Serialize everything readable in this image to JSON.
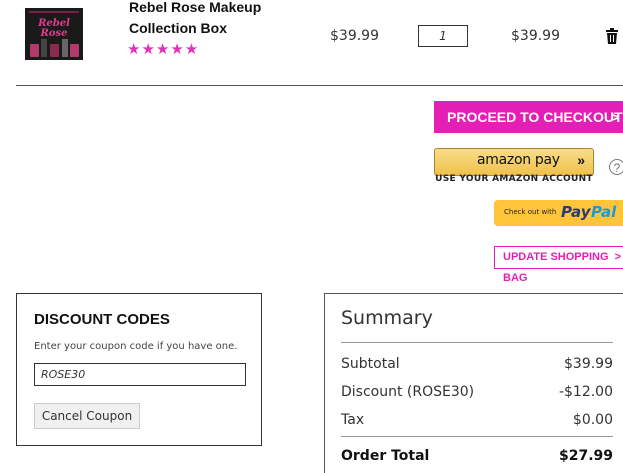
{
  "product": {
    "name_line1": "Rebel Rose Makeup",
    "name_line2": "Collection Box",
    "thumbnail_text": "Rebel Rose",
    "rating_stars": "★★★★★",
    "rating": 5,
    "unit_price": "$39.99",
    "quantity": "1",
    "line_total": "$39.99"
  },
  "checkout": {
    "proceed_label": "PROCEED TO CHECKOUT",
    "amazon_label": "amazon pay",
    "amazon_sub": "USE YOUR AMAZON ACCOUNT",
    "help_glyph": "?",
    "paypal_prefix": "Check out with",
    "paypal_pay": "Pay",
    "paypal_pal": "Pal",
    "update_label": "UPDATE SHOPPING BAG"
  },
  "discount": {
    "title": "DISCOUNT CODES",
    "hint": "Enter your coupon code if you have one.",
    "code_value": "ROSE30",
    "cancel_label": "Cancel Coupon"
  },
  "summary": {
    "title": "Summary",
    "rows": [
      {
        "label": "Subtotal",
        "value": "$39.99"
      },
      {
        "label": "Discount (ROSE30)",
        "value": "-$12.00"
      },
      {
        "label": "Tax",
        "value": "$0.00"
      }
    ],
    "total_label": "Order Total",
    "total_value": "$27.99"
  },
  "colors": {
    "accent": "#e31fb6",
    "amazon": "#f0c14b",
    "paypal": "#ffc439"
  },
  "icons": {
    "trash": "trash-icon",
    "chevron": "chevron-right-icon",
    "amazon_arrows": "double-chevron-icon",
    "help": "help-circle-icon"
  }
}
